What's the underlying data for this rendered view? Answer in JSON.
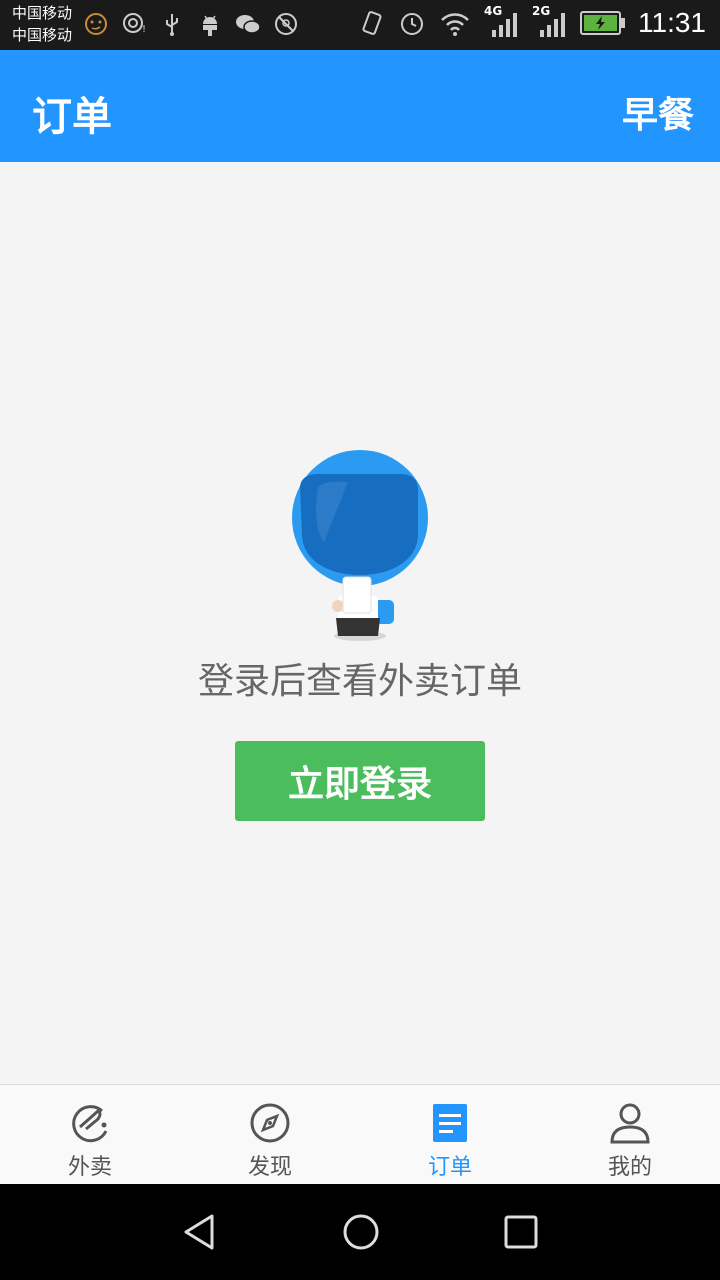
{
  "status_bar": {
    "carrier_1": "中国移动",
    "carrier_2": "中国移动",
    "network_1": "4G",
    "network_2": "2G",
    "time": "11:31",
    "left_icons": [
      "face-icon",
      "location-target-icon",
      "usb-icon",
      "android-icon",
      "wechat-icon",
      "no-location-icon"
    ],
    "right_icons": [
      "vibrate-icon",
      "alarm-icon",
      "wifi-icon",
      "signal-icon",
      "signal-icon",
      "battery-charging-icon"
    ]
  },
  "header": {
    "title": "订单",
    "action": "早餐"
  },
  "empty_state": {
    "message": "登录后查看外卖订单",
    "login_button": "立即登录",
    "illustration": "mascot-icon"
  },
  "tabs": [
    {
      "label": "外卖",
      "icon": "eleme-logo-icon",
      "active": false
    },
    {
      "label": "发现",
      "icon": "compass-icon",
      "active": false
    },
    {
      "label": "订单",
      "icon": "order-list-icon",
      "active": true
    },
    {
      "label": "我的",
      "icon": "person-icon",
      "active": false
    }
  ],
  "nav_bar": [
    "back-icon",
    "home-icon",
    "recents-icon"
  ],
  "colors": {
    "primary": "#2395ff",
    "login_button": "#4cbd5d",
    "background": "#f4f4f4",
    "status_bar": "#1a1a1a"
  }
}
